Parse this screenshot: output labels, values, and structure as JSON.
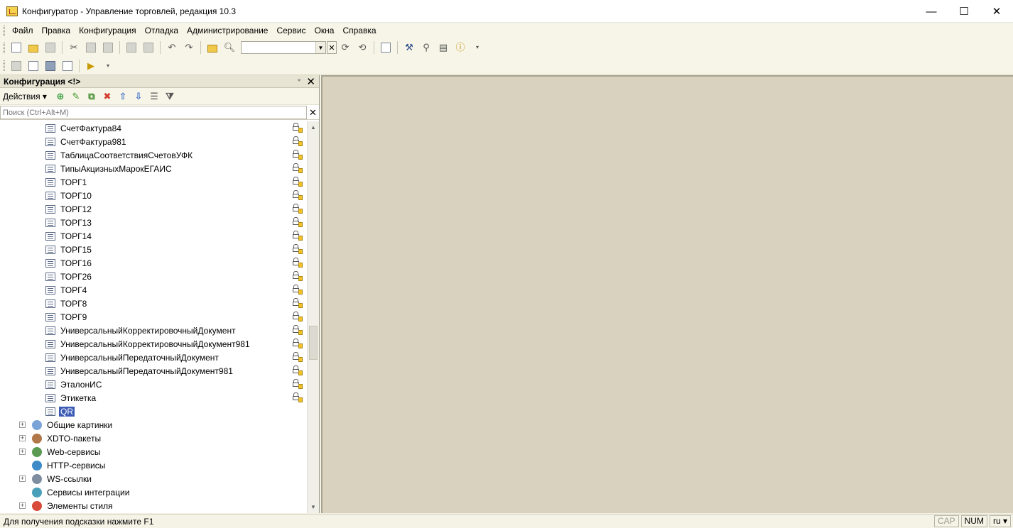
{
  "window": {
    "title": "Конфигуратор - Управление торговлей, редакция 10.3",
    "minimize": "—",
    "maximize": "☐",
    "close": "✕"
  },
  "menu": [
    {
      "label": "Файл"
    },
    {
      "label": "Правка"
    },
    {
      "label": "Конфигурация"
    },
    {
      "label": "Отладка"
    },
    {
      "label": "Администрирование"
    },
    {
      "label": "Сервис"
    },
    {
      "label": "Окна"
    },
    {
      "label": "Справка"
    }
  ],
  "toolbar": {
    "search_value": "",
    "search_dropdown": "▼",
    "search_clear": "✕"
  },
  "panel": {
    "title": "Конфигурация <!>",
    "pin": "ᵠ",
    "close": "✕",
    "actions_label": "Действия ▾",
    "search_placeholder": "Поиск (Ctrl+Alt+M)",
    "search_clear": "✕"
  },
  "tree": {
    "forms": [
      "СчетФактура84",
      "СчетФактура981",
      "ТаблицаСоответствияСчетовУФК",
      "ТипыАкцизныхМарокЕГАИС",
      "ТОРГ1",
      "ТОРГ10",
      "ТОРГ12",
      "ТОРГ13",
      "ТОРГ14",
      "ТОРГ15",
      "ТОРГ16",
      "ТОРГ26",
      "ТОРГ4",
      "ТОРГ8",
      "ТОРГ9",
      "УниверсальныйКорректировочныйДокумент",
      "УниверсальныйКорректировочныйДокумент981",
      "УниверсальныйПередаточныйДокумент",
      "УниверсальныйПередаточныйДокумент981",
      "ЭталонИС",
      "Этикетка"
    ],
    "selected": "QR",
    "groups": [
      {
        "label": "Общие картинки",
        "expandable": true,
        "icon": "pictures-icon",
        "color": "#7aa4d8"
      },
      {
        "label": "XDTO-пакеты",
        "expandable": true,
        "icon": "xdto-icon",
        "color": "#b07848"
      },
      {
        "label": "Web-сервисы",
        "expandable": true,
        "icon": "web-service-icon",
        "color": "#5a9a52"
      },
      {
        "label": "HTTP-сервисы",
        "expandable": false,
        "icon": "http-service-icon",
        "color": "#3c8ac8"
      },
      {
        "label": "WS-ссылки",
        "expandable": true,
        "icon": "ws-link-icon",
        "color": "#7f8da0"
      },
      {
        "label": "Сервисы интеграции",
        "expandable": false,
        "icon": "integration-icon",
        "color": "#4aa0b8"
      },
      {
        "label": "Элементы стиля",
        "expandable": true,
        "icon": "style-icon",
        "color": "#d84a3a"
      }
    ]
  },
  "status": {
    "hint": "Для получения подсказки нажмите F1",
    "cap": "CAP",
    "num": "NUM",
    "lang": "ru ▾"
  }
}
